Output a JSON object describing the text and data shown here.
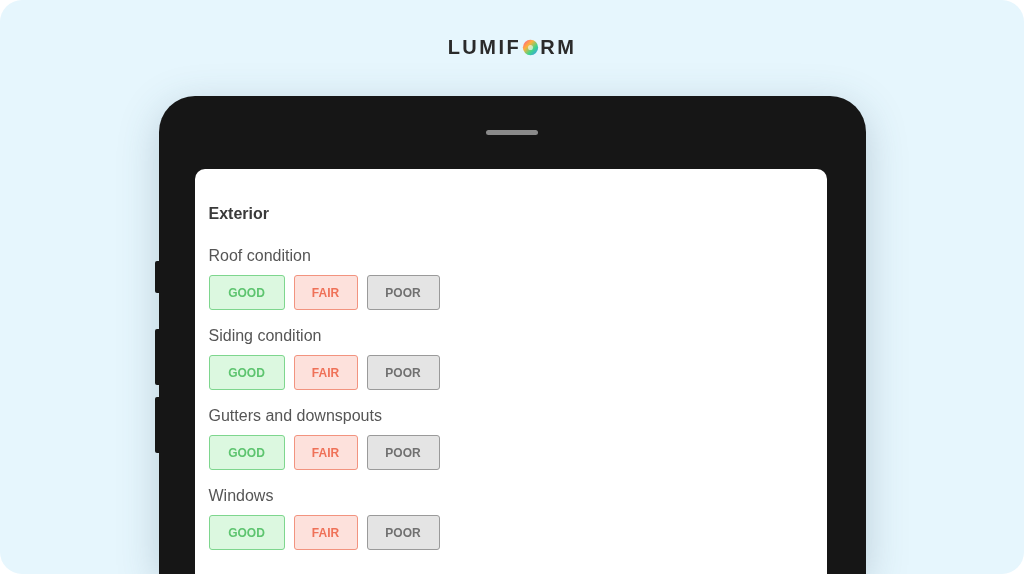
{
  "logo": {
    "before": "LUMIF",
    "after": "RM"
  },
  "section": {
    "title": "Exterior",
    "items": [
      {
        "label": "Roof condition",
        "options": [
          {
            "kind": "good",
            "label": "GOOD"
          },
          {
            "kind": "fair",
            "label": "FAIR"
          },
          {
            "kind": "poor",
            "label": "POOR"
          }
        ]
      },
      {
        "label": "Siding condition",
        "options": [
          {
            "kind": "good",
            "label": "GOOD"
          },
          {
            "kind": "fair",
            "label": "FAIR"
          },
          {
            "kind": "poor",
            "label": "POOR"
          }
        ]
      },
      {
        "label": "Gutters and downspouts",
        "options": [
          {
            "kind": "good",
            "label": "GOOD"
          },
          {
            "kind": "fair",
            "label": "FAIR"
          },
          {
            "kind": "poor",
            "label": "POOR"
          }
        ]
      },
      {
        "label": "Windows",
        "options": [
          {
            "kind": "good",
            "label": "GOOD"
          },
          {
            "kind": "fair",
            "label": "FAIR"
          },
          {
            "kind": "poor",
            "label": "POOR"
          }
        ]
      }
    ]
  }
}
